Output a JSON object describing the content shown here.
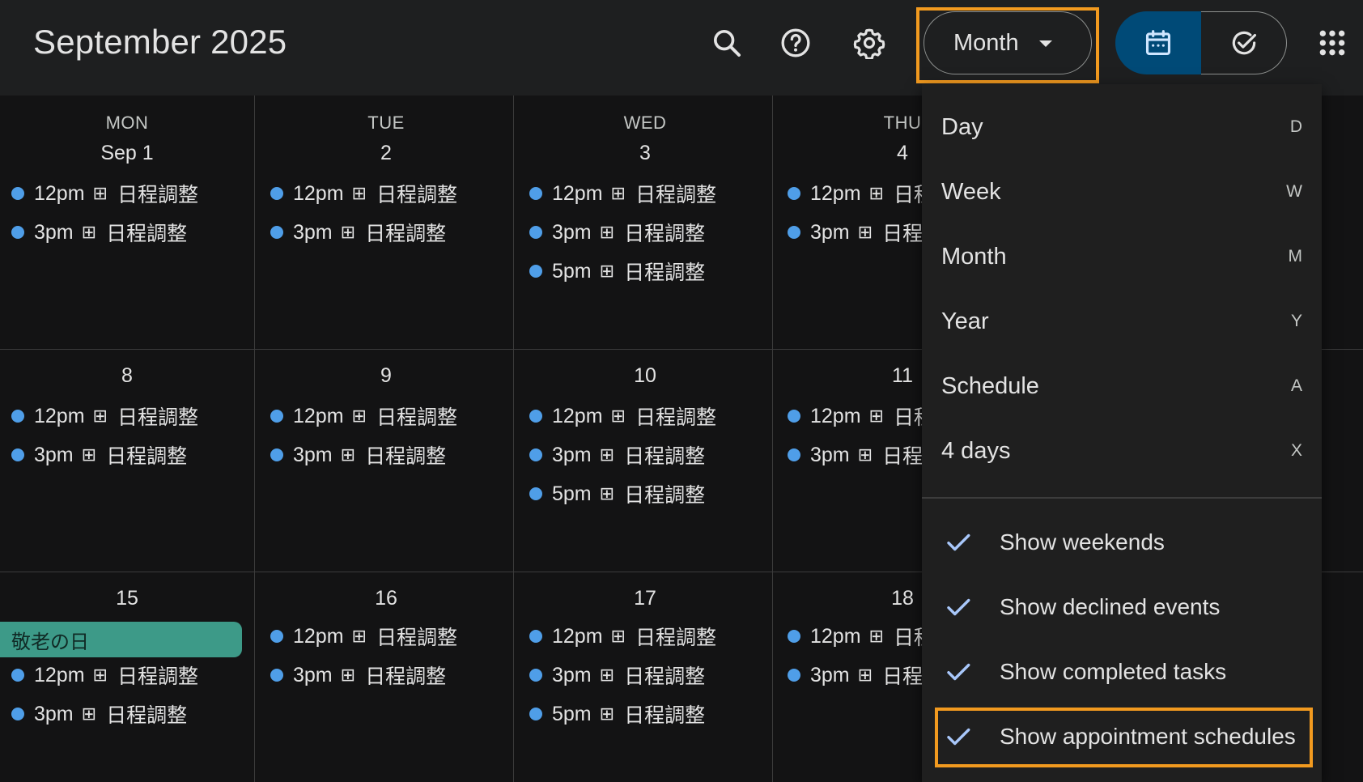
{
  "header": {
    "title": "September 2025",
    "view_label": "Month"
  },
  "weekdays": [
    "MON",
    "TUE",
    "WED",
    "THU"
  ],
  "weeks": [
    {
      "days": [
        {
          "num": "Sep 1",
          "events": [
            {
              "time": "12pm",
              "title": "日程調整"
            },
            {
              "time": "3pm",
              "title": "日程調整"
            }
          ]
        },
        {
          "num": "2",
          "events": [
            {
              "time": "12pm",
              "title": "日程調整"
            },
            {
              "time": "3pm",
              "title": "日程調整"
            }
          ]
        },
        {
          "num": "3",
          "events": [
            {
              "time": "12pm",
              "title": "日程調整"
            },
            {
              "time": "3pm",
              "title": "日程調整"
            },
            {
              "time": "5pm",
              "title": "日程調整"
            }
          ]
        },
        {
          "num": "4",
          "events": [
            {
              "time": "12pm",
              "title": "日程調整"
            },
            {
              "time": "3pm",
              "title": "日程調整"
            }
          ]
        }
      ]
    },
    {
      "days": [
        {
          "num": "8",
          "events": [
            {
              "time": "12pm",
              "title": "日程調整"
            },
            {
              "time": "3pm",
              "title": "日程調整"
            }
          ]
        },
        {
          "num": "9",
          "events": [
            {
              "time": "12pm",
              "title": "日程調整"
            },
            {
              "time": "3pm",
              "title": "日程調整"
            }
          ]
        },
        {
          "num": "10",
          "events": [
            {
              "time": "12pm",
              "title": "日程調整"
            },
            {
              "time": "3pm",
              "title": "日程調整"
            },
            {
              "time": "5pm",
              "title": "日程調整"
            }
          ]
        },
        {
          "num": "11",
          "events": [
            {
              "time": "12pm",
              "title": "日程調整"
            },
            {
              "time": "3pm",
              "title": "日程調整"
            }
          ]
        }
      ]
    },
    {
      "days": [
        {
          "num": "15",
          "holiday": "敬老の日",
          "events": [
            {
              "time": "12pm",
              "title": "日程調整"
            },
            {
              "time": "3pm",
              "title": "日程調整"
            }
          ]
        },
        {
          "num": "16",
          "events": [
            {
              "time": "12pm",
              "title": "日程調整"
            },
            {
              "time": "3pm",
              "title": "日程調整"
            }
          ]
        },
        {
          "num": "17",
          "events": [
            {
              "time": "12pm",
              "title": "日程調整"
            },
            {
              "time": "3pm",
              "title": "日程調整"
            },
            {
              "time": "5pm",
              "title": "日程調整"
            }
          ]
        },
        {
          "num": "18",
          "events": [
            {
              "time": "12pm",
              "title": "日程調整"
            },
            {
              "time": "3pm",
              "title": "日程調整"
            }
          ]
        }
      ]
    }
  ],
  "event_icon": "⊞",
  "menu": {
    "views": [
      {
        "label": "Day",
        "key": "D"
      },
      {
        "label": "Week",
        "key": "W"
      },
      {
        "label": "Month",
        "key": "M"
      },
      {
        "label": "Year",
        "key": "Y"
      },
      {
        "label": "Schedule",
        "key": "A"
      },
      {
        "label": "4 days",
        "key": "X"
      }
    ],
    "options": [
      {
        "label": "Show weekends",
        "checked": true
      },
      {
        "label": "Show declined events",
        "checked": true
      },
      {
        "label": "Show completed tasks",
        "checked": true
      },
      {
        "label": "Show appointment schedules",
        "checked": true
      }
    ]
  },
  "colors": {
    "event_dot": "#4f9ee8",
    "holiday": "#3d9a88",
    "highlight": "#f29a1f",
    "toggle_active": "#004a77"
  },
  "icons": [
    "search-icon",
    "help-icon",
    "settings-icon",
    "calendar-icon",
    "tasks-check-icon",
    "apps-grid-icon",
    "checkmark-icon"
  ]
}
